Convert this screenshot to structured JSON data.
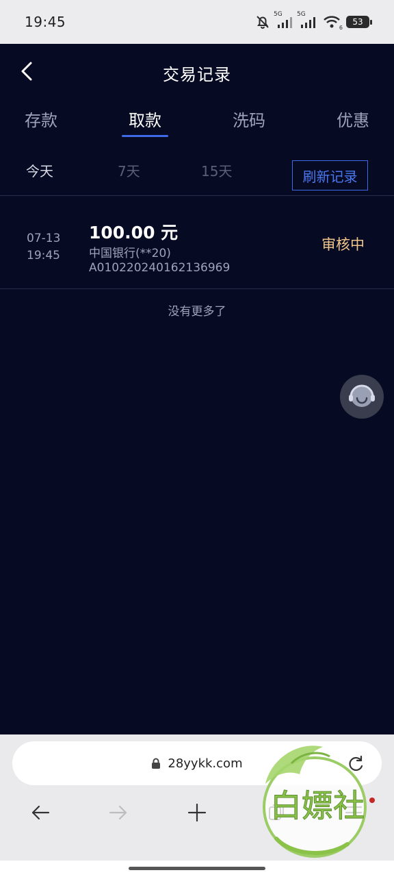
{
  "status_bar": {
    "time": "19:45",
    "net1": "5G",
    "net2": "5G",
    "wifi_badge": "6",
    "battery": "53",
    "icons": [
      "bell-muted-icon",
      "signal-5g-icon",
      "signal-5g-icon",
      "wifi-icon",
      "battery-icon"
    ]
  },
  "header": {
    "title": "交易记录",
    "back_icon": "chevron-left-icon"
  },
  "tabs": [
    {
      "label": "存款",
      "active": false
    },
    {
      "label": "取款",
      "active": true
    },
    {
      "label": "洗码",
      "active": false
    },
    {
      "label": "优惠",
      "active": false
    }
  ],
  "filters": {
    "today": "今天",
    "d7": "7天",
    "d15": "15天",
    "refresh": "刷新记录"
  },
  "records": [
    {
      "date": "07-13",
      "time": "19:45",
      "amount": "100.00 元",
      "bank": "中国银行(**20)",
      "order_no": "A010220240162136969",
      "status": "审核中"
    }
  ],
  "no_more": "没有更多了",
  "browser": {
    "url": "28yykk.com",
    "icons": [
      "lock-icon",
      "reload-icon",
      "back-arrow-icon",
      "forward-arrow-icon",
      "plus-icon",
      "tabs-icon",
      "menu-icon"
    ]
  },
  "watermark": {
    "text": "白嫖社"
  },
  "colors": {
    "app_bg": "#070a23",
    "accent": "#3f6ae8",
    "status_pending": "#f2c68b"
  }
}
